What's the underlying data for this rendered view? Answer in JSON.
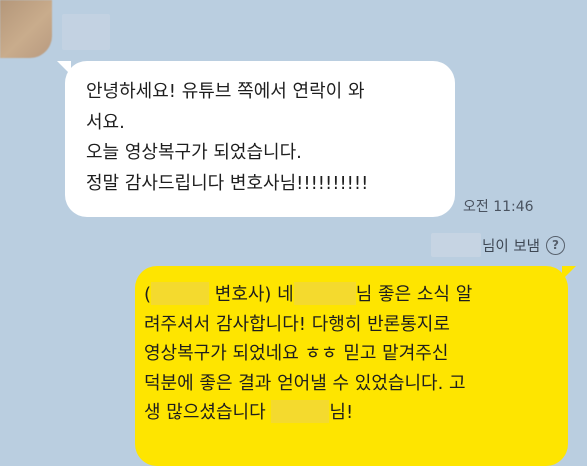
{
  "incoming": {
    "lines": [
      "안녕하세요! 유튜브 쪽에서 연락이 와",
      "서요.",
      "오늘 영상복구가 되었습니다.",
      "정말 감사드립니다 변호사님!!!!!!!!!!"
    ],
    "time": "오전 11:46"
  },
  "sent_by": {
    "label": "님이 보냄",
    "help_icon": "?"
  },
  "outgoing": {
    "line1": {
      "a": "(",
      "b": " 변호사) 네",
      "c": "님 좋은 소식 알"
    },
    "line2": "려주셔서 감사합니다! 다행히 반론통지로",
    "line3": "영상복구가 되었네요 ㅎㅎ 믿고 맡겨주신",
    "line4": "덕분에 좋은 결과 얻어낼 수 있었습니다. 고",
    "line5": {
      "a": "생 많으셨습니다",
      "b": "님!"
    }
  },
  "colors": {
    "background": "#bacee0",
    "incoming_bubble": "#ffffff",
    "outgoing_bubble": "#fee500"
  }
}
